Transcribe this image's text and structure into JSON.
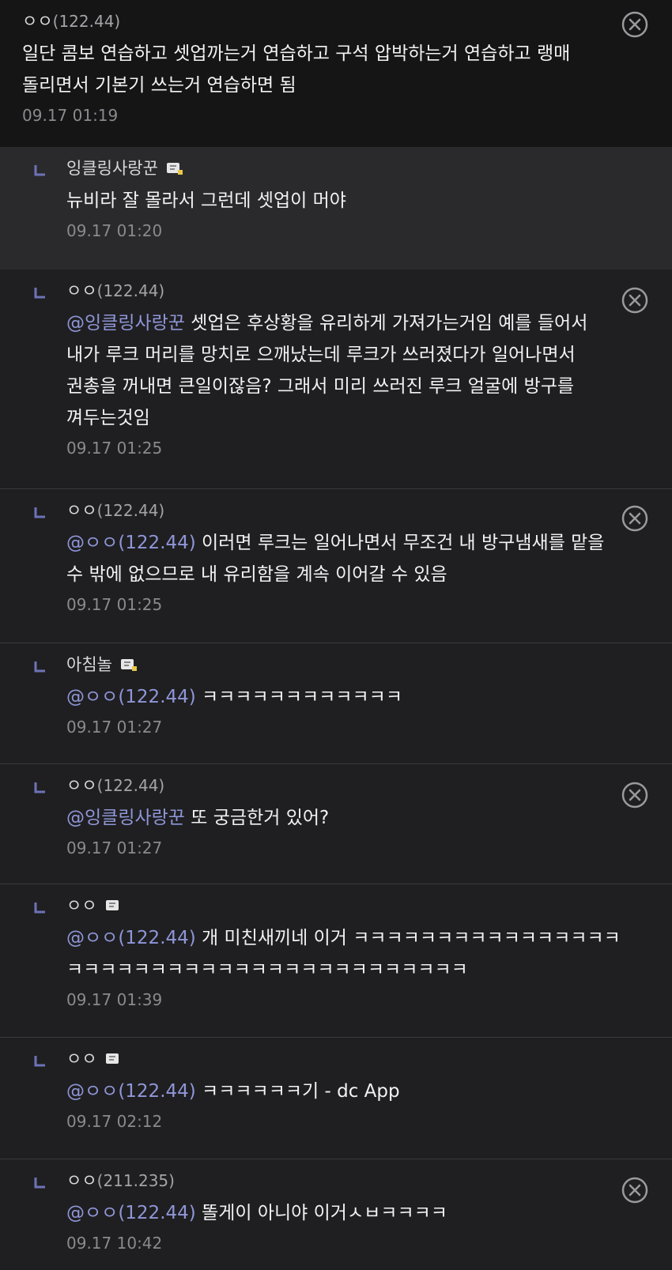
{
  "comments": [
    {
      "author": "ㅇㅇ",
      "ip": "(122.44)",
      "mention": "",
      "text": "일단 콤보 연습하고 셋업까는거 연습하고 구석 압박하는거 연습하고 랭매 돌리면서 기본기 쓰는거 연습하면 됨",
      "time": "09.17 01:19",
      "deletable": true
    },
    {
      "author": "잉클링사랑꾼",
      "ip": "",
      "mention": "",
      "text": "뉴비라 잘 몰라서 그런데 셋업이 머야",
      "time": "09.17 01:20",
      "deletable": false
    },
    {
      "author": "ㅇㅇ",
      "ip": "(122.44)",
      "mention": "@잉클링사랑꾼",
      "text": " 셋업은 후상황을 유리하게 가져가는거임 예를 들어서 내가 루크 머리를 망치로 으깨났는데 루크가 쓰러졌다가 일어나면서 권총을 꺼내면 큰일이잖음? 그래서 미리 쓰러진 루크 얼굴에 방구를 껴두는것임",
      "time": "09.17 01:25",
      "deletable": true
    },
    {
      "author": "ㅇㅇ",
      "ip": "(122.44)",
      "mention": "@ㅇㅇ(122.44)",
      "text": " 이러면 루크는 일어나면서 무조건 내 방구냄새를 맡을 수 밖에 없으므로 내 유리함을 계속 이어갈 수 있음",
      "time": "09.17 01:25",
      "deletable": true
    },
    {
      "author": "아침놀",
      "ip": "",
      "mention": "@ㅇㅇ(122.44)",
      "text": " ㅋㅋㅋㅋㅋㅋㅋㅋㅋㅋㅋㅋ",
      "time": "09.17 01:27",
      "deletable": false
    },
    {
      "author": "ㅇㅇ",
      "ip": "(122.44)",
      "mention": "@잉클링사랑꾼",
      "text": " 또 궁금한거 있어?",
      "time": "09.17 01:27",
      "deletable": true
    },
    {
      "author": "ㅇㅇ",
      "ip": "",
      "mention": "@ㅇㅇ(122.44)",
      "text": " 개 미친새끼네 이거 ㅋㅋㅋㅋㅋㅋㅋㅋㅋㅋㅋㅋㅋㅋㅋㅋㅋㅋㅋㅋㅋㅋㅋㅋㅋㅋㅋㅋㅋㅋㅋㅋㅋㅋㅋㅋㅋㅋㅋㅋ",
      "time": "09.17 01:39",
      "deletable": false
    },
    {
      "author": "ㅇㅇ",
      "ip": "",
      "mention": "@ㅇㅇ(122.44)",
      "text": " ㅋㅋㅋㅋㅋㅋ기 - dc App",
      "time": "09.17 02:12",
      "deletable": false
    },
    {
      "author": "ㅇㅇ",
      "ip": "(211.235)",
      "mention": "@ㅇㅇ(122.44)",
      "text": " 똘게이 아니야 이거ㅅㅂㅋㅋㅋㅋ",
      "time": "09.17 10:42",
      "deletable": true
    }
  ],
  "colors": {
    "background": "#1f1f21",
    "top_background": "#151516",
    "highlight_background": "#2a2a2d",
    "mention": "#8f96d8",
    "reply_arrow": "#6d73b8",
    "timestamp": "#8a8a8e"
  },
  "icons": {
    "reply": "reply-arrow-icon",
    "badge": "gallog-badge-icon",
    "delete": "delete-circle-x-icon"
  }
}
